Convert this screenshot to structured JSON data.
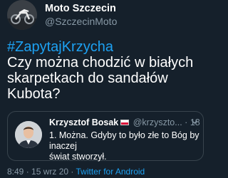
{
  "tweet": {
    "author_name": "Moto Szczecin",
    "author_handle": "@SzczecinMoto",
    "avatar_icon": "motorcycle-avatar-icon",
    "hashtag": "#ZapytajKrzycha",
    "text_lines": [
      "Czy można chodzić w białych",
      "skarpetkach do sandałów",
      "Kubota?"
    ]
  },
  "quote": {
    "author_name": "Krzysztof Bosak",
    "flag_icon": "poland-flag-icon",
    "author_handle": "@krzyszto...",
    "separator": "·",
    "time": "18 g.",
    "avatar_icon": "person-avatar-icon",
    "text_lines": [
      "1. Można. Gdyby to było złe to Bóg by inaczej",
      "świat stworzył."
    ]
  },
  "footer": {
    "time": "8:49",
    "separator_1": " · ",
    "date": "15 wrz 20",
    "separator_2": " · ",
    "source": "Twitter for Android"
  },
  "colors": {
    "background": "#15202b",
    "link": "#1da1f2",
    "secondary_text": "#8899a6",
    "border": "#38444d"
  }
}
